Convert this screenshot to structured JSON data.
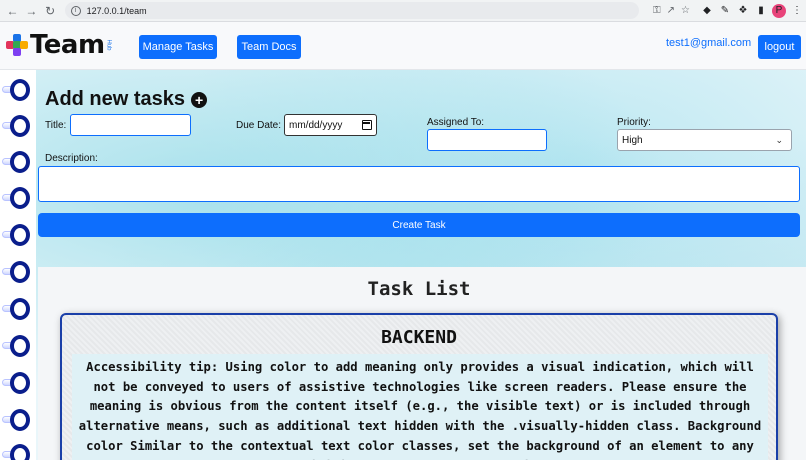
{
  "browser": {
    "url": "127.0.0.1/team",
    "profile_initial": "P"
  },
  "header": {
    "logo_text": "Team",
    "logo_sub": "Hub",
    "nav": {
      "manage_tasks": "Manage Tasks",
      "team_docs": "Team Docs"
    },
    "user_email": "test1@gmail.com",
    "logout_label": "logout"
  },
  "form": {
    "title": "Add new tasks",
    "title_label": "Title:",
    "title_value": "",
    "due_date_label": "Due Date:",
    "due_date_placeholder": "mm/dd/yyyy",
    "assigned_label": "Assigned To:",
    "assigned_value": "",
    "priority_label": "Priority:",
    "priority_value": "High",
    "description_label": "Description:",
    "description_value": "",
    "create_label": "Create Task"
  },
  "task_list": {
    "heading": "Task List",
    "cards": [
      {
        "title": "BACKEND",
        "body": "Accessibility tip: Using color to add meaning only provides a visual indication, which will not be conveyed to users of assistive technologies like screen readers. Please ensure the meaning is obvious from the content itself (e.g., the visible text) or is included through alternative means, such as additional text hidden with the .visually-hidden class. Background color Similar to the contextual text color classes, set the background of an element to any contextual class. Background utilities do not set color, so in some cases you'll want to use .text-* color"
      }
    ]
  },
  "colors": {
    "primary": "#0d6efd",
    "card_border": "#1a3fa8",
    "spiral": "#0a1e8c"
  }
}
